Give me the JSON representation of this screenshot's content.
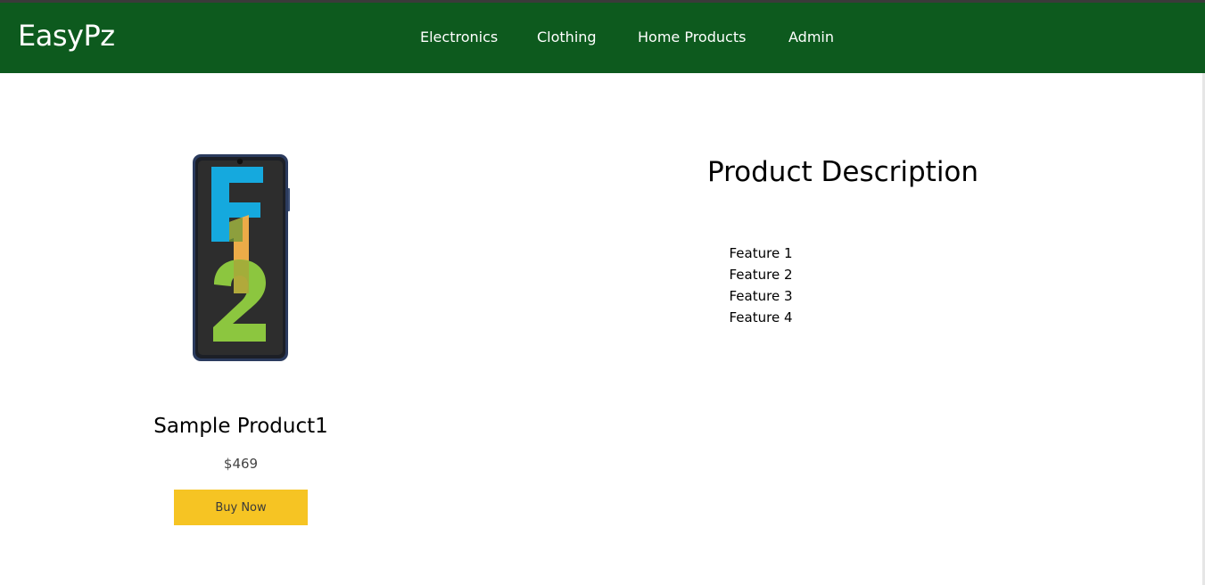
{
  "header": {
    "brand": "EasyPz",
    "nav": [
      {
        "label": "Electronics"
      },
      {
        "label": "Clothing"
      },
      {
        "label": "Home Products"
      },
      {
        "label": "Admin"
      }
    ]
  },
  "product": {
    "title": "Sample Product1",
    "price": "$469",
    "buy_label": "Buy Now",
    "image_text": "F12"
  },
  "description": {
    "title": "Product Description",
    "features": [
      "Feature 1",
      "Feature 2",
      "Feature 3",
      "Feature 4"
    ]
  },
  "colors": {
    "nav_bg": "#0d5a1e",
    "button_bg": "#f6c423"
  }
}
